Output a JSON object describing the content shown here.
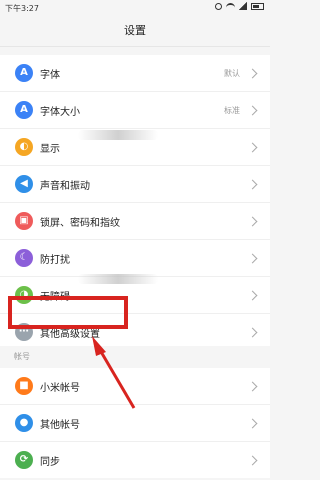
{
  "status_bar": {
    "time": "下午3:27"
  },
  "title": "设置",
  "settings": [
    {
      "label": "字体",
      "value": "默认",
      "icon": "font-icon",
      "color": "#3b82f6",
      "glyph": "A"
    },
    {
      "label": "字体大小",
      "value": "标准",
      "icon": "font-size-icon",
      "color": "#3b82f6",
      "glyph": "A"
    },
    {
      "label": "显示",
      "value": "",
      "icon": "display-icon",
      "color": "#f5a623",
      "glyph": "◐"
    },
    {
      "label": "声音和振动",
      "value": "",
      "icon": "sound-icon",
      "color": "#2f8fe8",
      "glyph": "◀"
    },
    {
      "label": "锁屏、密码和指纹",
      "value": "",
      "icon": "lock-icon",
      "color": "#ef5b5b",
      "glyph": "▣"
    },
    {
      "label": "防打扰",
      "value": "",
      "icon": "do-not-disturb-icon",
      "color": "#8c5fd9",
      "glyph": "☾"
    },
    {
      "label": "无障碍",
      "value": "",
      "icon": "accessibility-icon",
      "color": "#6cc04a",
      "glyph": "◑"
    },
    {
      "label": "其他高级设置",
      "value": "",
      "icon": "more-icon",
      "color": "#9aa4ad",
      "glyph": "⋯"
    }
  ],
  "accounts_header": "帐号",
  "accounts": [
    {
      "label": "小米帐号",
      "icon": "mi-account-icon",
      "color": "#ff7a1a",
      "glyph": "■"
    },
    {
      "label": "其他帐号",
      "icon": "other-account-icon",
      "color": "#2f8fe8",
      "glyph": "●"
    },
    {
      "label": "同步",
      "icon": "sync-icon",
      "color": "#4caf50",
      "glyph": "⟳"
    }
  ],
  "annotation_color": "#d8241f"
}
